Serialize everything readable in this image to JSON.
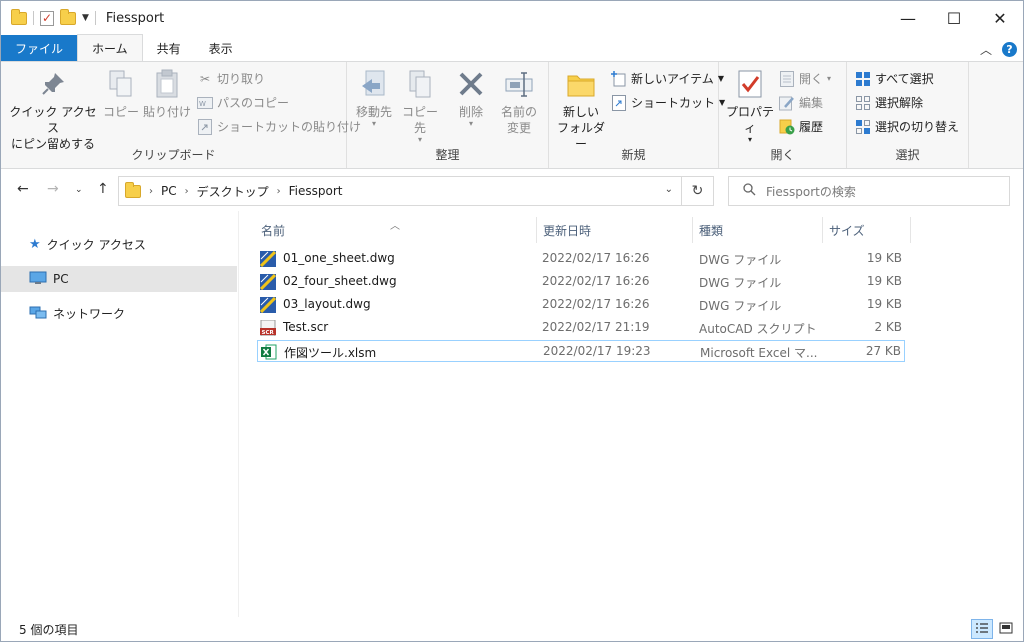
{
  "window": {
    "title": "Fiessport",
    "minimize_glyph": "—",
    "maximize_glyph": "☐",
    "close_glyph": "✕"
  },
  "ribbon_tabs": [
    "ファイル",
    "ホーム",
    "共有",
    "表示"
  ],
  "ribbon": {
    "clipboard": {
      "label": "クリップボード",
      "pin_line1": "クイック アクセス",
      "pin_line2": "にピン留めする",
      "copy": "コピー",
      "paste": "貼り付け",
      "cut": "切り取り",
      "copy_path": "パスのコピー",
      "paste_shortcut": "ショートカットの貼り付け"
    },
    "organize": {
      "label": "整理",
      "move_to": "移動先",
      "copy_to": "コピー先",
      "delete": "削除",
      "rename_line1": "名前の",
      "rename_line2": "変更"
    },
    "new": {
      "label": "新規",
      "new_folder_line1": "新しい",
      "new_folder_line2": "フォルダー",
      "new_item": "新しいアイテム",
      "shortcut": "ショートカット"
    },
    "open": {
      "label": "開く",
      "properties": "プロパティ",
      "open": "開く",
      "edit": "編集",
      "history": "履歴"
    },
    "select": {
      "label": "選択",
      "select_all": "すべて選択",
      "select_none": "選択解除",
      "invert": "選択の切り替え"
    }
  },
  "address": {
    "crumbs": [
      "PC",
      "デスクトップ",
      "Fiessport"
    ],
    "search_placeholder": "Fiessportの検索"
  },
  "nav_pane": {
    "items": [
      "クイック アクセス",
      "PC",
      "ネットワーク"
    ],
    "selected": "PC"
  },
  "columns": [
    "名前",
    "更新日時",
    "種類",
    "サイズ"
  ],
  "files": [
    {
      "name": "01_one_sheet.dwg",
      "modified": "2022/02/17 16:26",
      "type": "DWG ファイル",
      "size": "19 KB",
      "icon": "dwg-file-icon"
    },
    {
      "name": "02_four_sheet.dwg",
      "modified": "2022/02/17 16:26",
      "type": "DWG ファイル",
      "size": "19 KB",
      "icon": "dwg-file-icon"
    },
    {
      "name": "03_layout.dwg",
      "modified": "2022/02/17 16:26",
      "type": "DWG ファイル",
      "size": "19 KB",
      "icon": "dwg-file-icon"
    },
    {
      "name": "Test.scr",
      "modified": "2022/02/17 21:19",
      "type": "AutoCAD スクリプト",
      "size": "2 KB",
      "icon": "scr-file-icon"
    },
    {
      "name": "作図ツール.xlsm",
      "modified": "2022/02/17 19:23",
      "type": "Microsoft Excel マ...",
      "size": "27 KB",
      "icon": "excel-file-icon"
    }
  ],
  "status": {
    "item_count": "5 個の項目"
  },
  "colors": {
    "accent": "#1979ca",
    "selection_border": "#99d1ff",
    "folder": "#f7cf4a"
  }
}
